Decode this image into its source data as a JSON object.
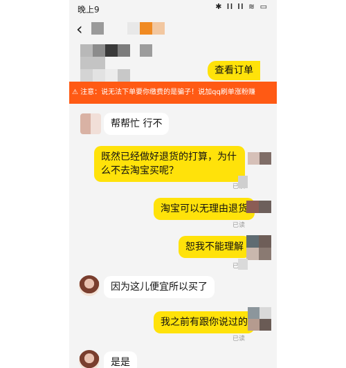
{
  "status": {
    "time": "晚上9",
    "icons": "✱ 𝐥𝐥 𝐥𝐥 ≋ ▭"
  },
  "nav": {
    "back": "‹"
  },
  "banner": {
    "text": "⚠ 注意：说无法下单要你缴费的是骗子！说加qq刷单涨粉赚"
  },
  "messages": [
    {
      "side": "me",
      "text": "查看订单"
    },
    {
      "side": "them",
      "text": "帮帮忙 行不"
    },
    {
      "side": "me",
      "text": "既然已经做好退货的打算，为什么不去淘宝买呢？",
      "status": "已读"
    },
    {
      "side": "me",
      "text": "淘宝可以无理由退货",
      "status": "已读"
    },
    {
      "side": "me",
      "text": "恕我不能理解",
      "status": "已读"
    },
    {
      "side": "them",
      "text": "因为这儿便宜所以买了"
    },
    {
      "side": "me",
      "text": "我之前有跟你说过的",
      "status": "已读"
    },
    {
      "side": "them",
      "text": "是是"
    }
  ],
  "colors": {
    "my_bubble": "#ffe20a",
    "banner": "#ff5a14",
    "background": "#f4f4f4"
  }
}
